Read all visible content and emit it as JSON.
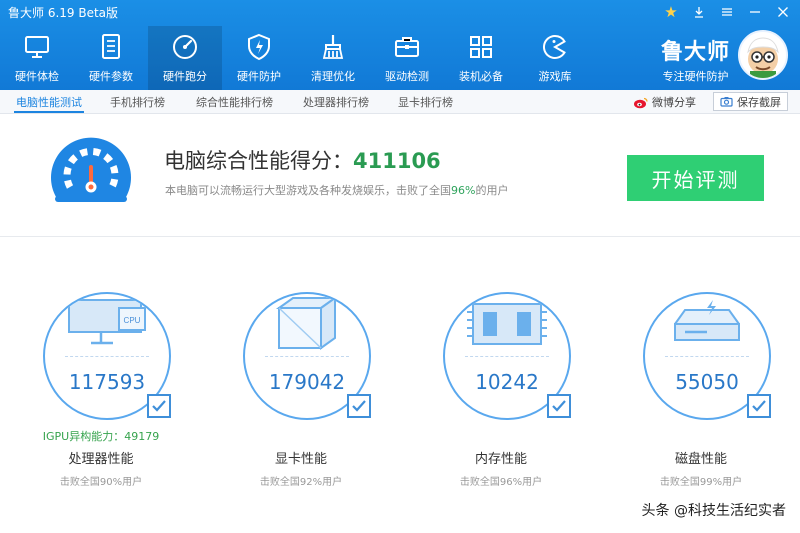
{
  "window": {
    "title": "鲁大师 6.19 Beta版"
  },
  "toolbar": {
    "items": [
      {
        "label": "硬件体检",
        "icon": "monitor-icon"
      },
      {
        "label": "硬件参数",
        "icon": "document-list-icon"
      },
      {
        "label": "硬件跑分",
        "icon": "speedometer-icon",
        "active": true
      },
      {
        "label": "硬件防护",
        "icon": "shield-bolt-icon"
      },
      {
        "label": "清理优化",
        "icon": "broom-icon"
      },
      {
        "label": "驱动检测",
        "icon": "toolbox-icon"
      },
      {
        "label": "装机必备",
        "icon": "app-grid-icon"
      },
      {
        "label": "游戏库",
        "icon": "game-pacman-icon"
      }
    ]
  },
  "brand": {
    "name": "鲁大师",
    "slogan": "专注硬件防护"
  },
  "subtabs": [
    {
      "label": "电脑性能测试",
      "active": true
    },
    {
      "label": "手机排行榜"
    },
    {
      "label": "综合性能排行榜"
    },
    {
      "label": "处理器排行榜"
    },
    {
      "label": "显卡排行榜"
    }
  ],
  "share": {
    "label": "微博分享"
  },
  "save_screenshot": {
    "label": "保存截屏"
  },
  "score": {
    "title_prefix": "电脑综合性能得分：",
    "value": "411106",
    "desc_prefix": "本电脑可以流畅运行大型游戏及各种发烧娱乐，击败了全国",
    "desc_percent": "96%",
    "desc_suffix": "的用户"
  },
  "start_button": {
    "label": "开始评测"
  },
  "cards": [
    {
      "value": "117593",
      "name": "处理器性能",
      "sub": "击败全国90%用户",
      "extra": "IGPU异构能力：49179",
      "icon": "monitor-cpu-icon",
      "cpu_chip_text": "CPU"
    },
    {
      "value": "179042",
      "name": "显卡性能",
      "sub": "击败全国92%用户",
      "extra": "",
      "icon": "gpu-cube-icon"
    },
    {
      "value": "10242",
      "name": "内存性能",
      "sub": "击败全国96%用户",
      "extra": "",
      "icon": "memory-chip-icon"
    },
    {
      "value": "55050",
      "name": "磁盘性能",
      "sub": "击败全国99%用户",
      "extra": "",
      "icon": "disk-drive-icon"
    }
  ],
  "watermark": "头条 @科技生活纪实者",
  "colors": {
    "toolbar": "#1179d6",
    "accent": "#1c84e0",
    "score_green": "#2a9b52",
    "start_button": "#2fcf74"
  }
}
